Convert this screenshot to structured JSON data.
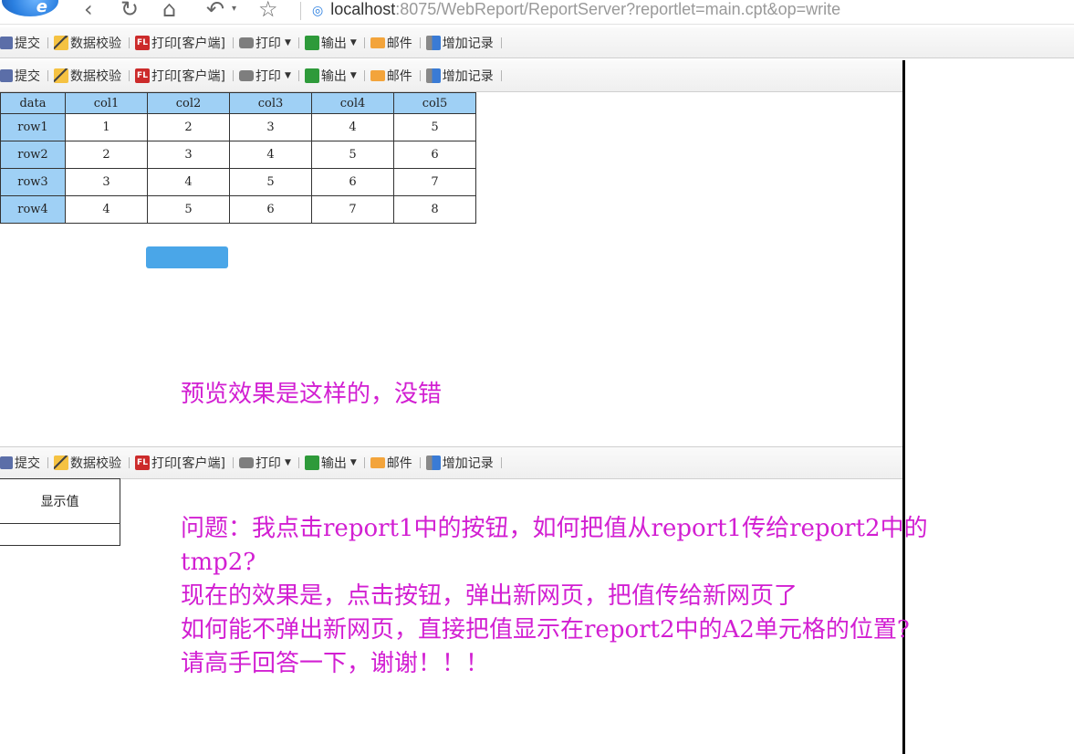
{
  "browser": {
    "url_host": "localhost",
    "url_rest": ":8075/WebReport/ReportServer?reportlet=main.cpt&op=write"
  },
  "toolbar": {
    "submit": "提交",
    "validate": "数据校验",
    "print_client": "打印[客户端]",
    "print": "打印",
    "export": "输出",
    "mail": "邮件",
    "add_record": "增加记录"
  },
  "table": {
    "header": [
      "data",
      "col1",
      "col2",
      "col3",
      "col4",
      "col5"
    ],
    "rows": [
      [
        "row1",
        "1",
        "2",
        "3",
        "4",
        "5"
      ],
      [
        "row2",
        "2",
        "3",
        "4",
        "5",
        "6"
      ],
      [
        "row3",
        "3",
        "4",
        "5",
        "6",
        "7"
      ],
      [
        "row4",
        "4",
        "5",
        "6",
        "7",
        "8"
      ]
    ]
  },
  "annotations": {
    "preview_note": "预览效果是这样的，没错",
    "question_lines": [
      "问题：我点击report1中的按钮，如何把值从report1传给report2中的",
      "tmp2?",
      "现在的效果是，点击按钮，弹出新网页，把值传给新网页了",
      "如何能不弹出新网页，直接把值显示在report2中的A2单元格的位置?",
      "请高手回答一下，谢谢！！！"
    ]
  },
  "report2": {
    "display_label": "显示值",
    "value": ""
  },
  "colors": {
    "header_bg": "#9fd0f5",
    "button": "#4aa6e8",
    "annotation": "#d21fd2"
  }
}
